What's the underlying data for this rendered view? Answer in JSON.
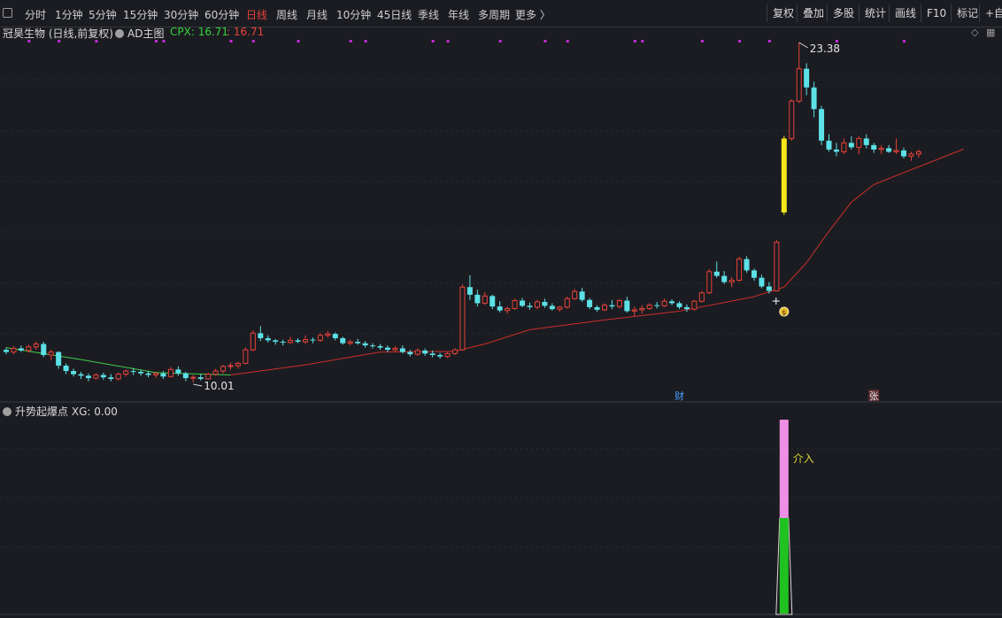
{
  "toolbar": {
    "periods": [
      "分时",
      "1分钟",
      "5分钟",
      "15分钟",
      "30分钟",
      "60分钟",
      "日线",
      "周线",
      "月线",
      "10分钟",
      "45日线",
      "季线",
      "年线",
      "多周期",
      "更多 〉"
    ],
    "active_period": "日线",
    "right_buttons": [
      "复权",
      "叠加",
      "多股",
      "统计",
      "画线",
      "F10",
      "标记",
      "+自"
    ]
  },
  "main_chart": {
    "stock_title": "冠昊生物 (日线,前复权)",
    "indicator_name": "AD主图",
    "cpx_label": "CPX: 16.71",
    "cpx_value2": ": 16.71",
    "max_label": "23.38",
    "min_label": "10.01",
    "markers": {
      "cai": "财",
      "zhang": "张"
    }
  },
  "sub_chart": {
    "title": "升势起爆点",
    "xg_label": "XG: 0.00",
    "signal_label": "介入"
  },
  "colors": {
    "background": "#1b1c21",
    "up": "#e8423a",
    "down": "#5ce1e6",
    "ma_up": "#cc2f2a",
    "ma_down": "#3fcf4a",
    "signal_yellow": "#f5e71b",
    "dots": "#c42bd6",
    "bar_pink": "#ee8ee4",
    "bar_green": "#21c21f",
    "cpx_green": "#35d13a",
    "signal_label": "#d6d634"
  },
  "chart_data": {
    "type": "candlestick",
    "title": "冠昊生物 (日线,前复权)",
    "candles": [
      [
        10.86,
        10.92,
        10.74,
        10.8
      ],
      [
        10.8,
        10.96,
        10.74,
        10.9
      ],
      [
        10.9,
        10.98,
        10.8,
        10.84
      ],
      [
        10.84,
        11.0,
        10.78,
        10.94
      ],
      [
        10.94,
        11.08,
        10.86,
        11.02
      ],
      [
        11.02,
        11.08,
        10.66,
        10.72
      ],
      [
        10.72,
        10.86,
        10.58,
        10.8
      ],
      [
        10.8,
        10.82,
        10.36,
        10.44
      ],
      [
        10.44,
        10.5,
        10.22,
        10.3
      ],
      [
        10.3,
        10.36,
        10.16,
        10.22
      ],
      [
        10.22,
        10.28,
        10.1,
        10.18
      ],
      [
        10.18,
        10.24,
        10.04,
        10.12
      ],
      [
        10.12,
        10.24,
        10.08,
        10.2
      ],
      [
        10.2,
        10.26,
        10.08,
        10.14
      ],
      [
        10.14,
        10.22,
        10.04,
        10.1
      ],
      [
        10.1,
        10.26,
        10.06,
        10.22
      ],
      [
        10.22,
        10.34,
        10.16,
        10.3
      ],
      [
        10.3,
        10.38,
        10.2,
        10.28
      ],
      [
        10.28,
        10.34,
        10.18,
        10.24
      ],
      [
        10.24,
        10.3,
        10.14,
        10.2
      ],
      [
        10.2,
        10.28,
        10.12,
        10.24
      ],
      [
        10.24,
        10.3,
        10.1,
        10.16
      ],
      [
        10.16,
        10.4,
        10.14,
        10.34
      ],
      [
        10.34,
        10.42,
        10.18,
        10.24
      ],
      [
        10.24,
        10.28,
        10.04,
        10.12
      ],
      [
        10.12,
        10.2,
        10.01,
        10.14
      ],
      [
        10.14,
        10.22,
        10.06,
        10.1
      ],
      [
        10.1,
        10.26,
        10.08,
        10.22
      ],
      [
        10.22,
        10.36,
        10.18,
        10.3
      ],
      [
        10.3,
        10.46,
        10.24,
        10.42
      ],
      [
        10.42,
        10.52,
        10.34,
        10.44
      ],
      [
        10.44,
        10.54,
        10.36,
        10.5
      ],
      [
        10.5,
        10.92,
        10.48,
        10.86
      ],
      [
        10.86,
        11.4,
        10.82,
        11.32
      ],
      [
        11.32,
        11.52,
        11.1,
        11.18
      ],
      [
        11.18,
        11.26,
        11.06,
        11.12
      ],
      [
        11.12,
        11.16,
        11.0,
        11.08
      ],
      [
        11.08,
        11.14,
        10.98,
        11.06
      ],
      [
        11.06,
        11.22,
        11.02,
        11.12
      ],
      [
        11.12,
        11.18,
        11.04,
        11.08
      ],
      [
        11.08,
        11.26,
        11.02,
        11.14
      ],
      [
        11.14,
        11.2,
        11.04,
        11.12
      ],
      [
        11.12,
        11.32,
        11.08,
        11.26
      ],
      [
        11.26,
        11.38,
        11.2,
        11.3
      ],
      [
        11.3,
        11.34,
        11.12,
        11.18
      ],
      [
        11.18,
        11.22,
        11.0,
        11.04
      ],
      [
        11.04,
        11.14,
        10.98,
        11.08
      ],
      [
        11.08,
        11.16,
        11.0,
        11.04
      ],
      [
        11.04,
        11.1,
        10.92,
        10.98
      ],
      [
        10.98,
        11.04,
        10.9,
        10.96
      ],
      [
        10.96,
        11.02,
        10.86,
        10.92
      ],
      [
        10.92,
        10.98,
        10.8,
        10.86
      ],
      [
        10.86,
        10.96,
        10.82,
        10.9
      ],
      [
        10.9,
        10.98,
        10.76,
        10.8
      ],
      [
        10.8,
        10.86,
        10.68,
        10.74
      ],
      [
        10.74,
        10.9,
        10.7,
        10.84
      ],
      [
        10.84,
        10.9,
        10.7,
        10.76
      ],
      [
        10.76,
        10.84,
        10.66,
        10.72
      ],
      [
        10.72,
        10.78,
        10.62,
        10.68
      ],
      [
        10.68,
        10.8,
        10.64,
        10.76
      ],
      [
        10.76,
        10.9,
        10.72,
        10.86
      ],
      [
        10.86,
        12.78,
        10.84,
        12.7
      ],
      [
        12.7,
        13.08,
        12.3,
        12.46
      ],
      [
        12.46,
        12.62,
        12.1,
        12.2
      ],
      [
        12.2,
        12.54,
        12.14,
        12.42
      ],
      [
        12.42,
        12.46,
        12.02,
        12.1
      ],
      [
        12.1,
        12.26,
        11.92,
        11.98
      ],
      [
        11.98,
        12.1,
        11.88,
        12.04
      ],
      [
        12.04,
        12.34,
        12.0,
        12.28
      ],
      [
        12.28,
        12.36,
        12.08,
        12.12
      ],
      [
        12.12,
        12.22,
        12.0,
        12.08
      ],
      [
        12.08,
        12.3,
        12.02,
        12.24
      ],
      [
        12.24,
        12.34,
        12.06,
        12.12
      ],
      [
        12.12,
        12.2,
        11.98,
        12.02
      ],
      [
        12.02,
        12.12,
        11.94,
        12.08
      ],
      [
        12.08,
        12.4,
        12.04,
        12.34
      ],
      [
        12.34,
        12.64,
        12.3,
        12.56
      ],
      [
        12.56,
        12.68,
        12.24,
        12.3
      ],
      [
        12.3,
        12.36,
        12.02,
        12.08
      ],
      [
        12.08,
        12.14,
        11.94,
        12.0
      ],
      [
        12.0,
        12.2,
        11.96,
        12.14
      ],
      [
        12.14,
        12.3,
        12.02,
        12.1
      ],
      [
        12.1,
        12.32,
        12.04,
        12.28
      ],
      [
        12.28,
        12.4,
        11.92,
        11.96
      ],
      [
        11.96,
        12.1,
        11.8,
        12.0
      ],
      [
        12.0,
        12.14,
        11.88,
        12.04
      ],
      [
        12.04,
        12.2,
        12.0,
        12.14
      ],
      [
        12.14,
        12.24,
        12.04,
        12.12
      ],
      [
        12.12,
        12.34,
        12.08,
        12.26
      ],
      [
        12.26,
        12.32,
        12.14,
        12.2
      ],
      [
        12.2,
        12.26,
        12.02,
        12.08
      ],
      [
        12.08,
        12.16,
        11.94,
        12.02
      ],
      [
        12.02,
        12.3,
        11.98,
        12.26
      ],
      [
        12.26,
        12.58,
        12.22,
        12.52
      ],
      [
        12.52,
        13.28,
        12.48,
        13.2
      ],
      [
        13.2,
        13.54,
        13.0,
        13.06
      ],
      [
        13.06,
        13.22,
        12.8,
        12.86
      ],
      [
        12.86,
        13.02,
        12.7,
        12.92
      ],
      [
        12.92,
        13.7,
        12.88,
        13.62
      ],
      [
        13.62,
        13.72,
        13.16,
        13.24
      ],
      [
        13.24,
        13.3,
        12.9,
        13.0
      ],
      [
        13.0,
        13.1,
        12.66,
        12.72
      ],
      [
        12.72,
        12.86,
        12.5,
        12.58
      ],
      [
        12.58,
        14.28,
        12.56,
        14.2
      ],
      [
        15.3,
        18.52,
        15.2,
        18.4
      ],
      [
        18.4,
        20.3,
        18.3,
        20.2
      ],
      [
        20.2,
        23.38,
        20.1,
        21.9
      ],
      [
        21.9,
        22.2,
        20.5,
        20.9
      ],
      [
        20.9,
        21.2,
        19.4,
        19.8
      ],
      [
        19.8,
        19.96,
        18.1,
        18.3
      ],
      [
        18.3,
        18.6,
        17.8,
        17.9
      ],
      [
        17.9,
        18.2,
        17.6,
        17.8
      ],
      [
        17.8,
        18.4,
        17.7,
        18.2
      ],
      [
        18.2,
        18.5,
        17.9,
        18.0
      ],
      [
        18.0,
        18.5,
        17.7,
        18.4
      ],
      [
        18.4,
        18.6,
        17.95,
        18.1
      ],
      [
        18.1,
        18.2,
        17.75,
        17.9
      ],
      [
        17.9,
        18.1,
        17.7,
        17.96
      ],
      [
        17.96,
        18.1,
        17.75,
        17.8
      ],
      [
        17.8,
        18.4,
        17.7,
        17.86
      ],
      [
        17.86,
        17.99,
        17.5,
        17.6
      ],
      [
        17.6,
        17.8,
        17.4,
        17.7
      ],
      [
        17.7,
        17.9,
        17.55,
        17.8
      ]
    ],
    "signal_candle_index": 104,
    "ma_line_points": [
      [
        0,
        10.92
      ],
      [
        10,
        10.6
      ],
      [
        20,
        10.26
      ],
      [
        30,
        10.2
      ],
      [
        40,
        10.46
      ],
      [
        50,
        10.8
      ],
      [
        60,
        10.82
      ],
      [
        64,
        11.02
      ],
      [
        70,
        11.42
      ],
      [
        80,
        11.7
      ],
      [
        90,
        11.96
      ],
      [
        100,
        12.4
      ],
      [
        104,
        12.7
      ],
      [
        107,
        13.5
      ],
      [
        110,
        14.6
      ],
      [
        113,
        15.7
      ],
      [
        116,
        16.4
      ],
      [
        120,
        16.9
      ],
      [
        124,
        17.4
      ],
      [
        128,
        17.92
      ]
    ],
    "ylim": [
      10.01,
      23.38
    ],
    "subplot": {
      "title": "升势起爆点",
      "xg": 0.0,
      "signal_index": 104,
      "signal_label": "介入"
    }
  }
}
